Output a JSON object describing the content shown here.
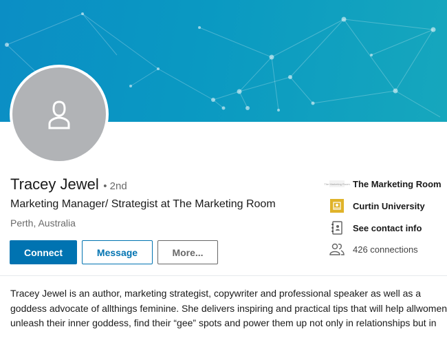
{
  "profile": {
    "name": "Tracey Jewel",
    "degree": "• 2nd",
    "headline": "Marketing Manager/ Strategist at The Marketing Room",
    "location": "Perth, Australia"
  },
  "actions": {
    "connect_label": "Connect",
    "message_label": "Message",
    "more_label": "More..."
  },
  "sidebar": {
    "company": "The Marketing Room",
    "company_logo_text": "The Marketing Room",
    "school": "Curtin University",
    "contact": "See contact info",
    "connections": "426 connections"
  },
  "summary": {
    "lines": [
      "Tracey Jewel is an author, marketing strategist, copywriter and professional speaker as well as a",
      "goddess advocate of allthings feminine. She delivers inspiring and practical tips that will help allwomen",
      "unleash their inner goddess, find their “gee” spots and power them up not only in relationships but in"
    ]
  },
  "colors": {
    "brand": "#0073b1",
    "banner": "#0a99c2",
    "avatar_bg": "#b1b3b6",
    "curtin_gold": "#e0b32a"
  }
}
